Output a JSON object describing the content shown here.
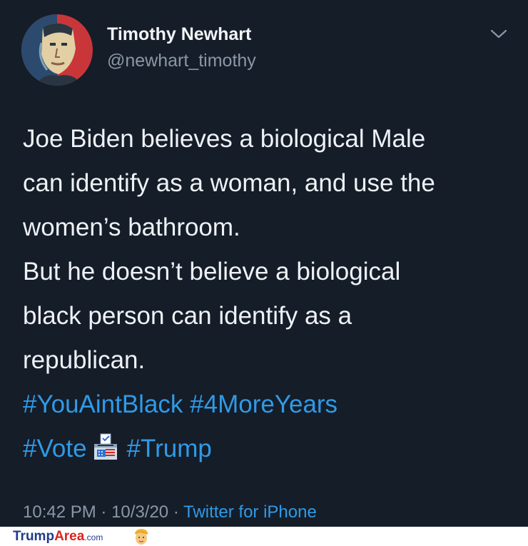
{
  "tweet": {
    "author_name": "Timothy Newhart",
    "author_handle": "@newhart_timothy",
    "lines": [
      "Joe Biden believes a biological Male",
      "can identify as a woman, and use the",
      "women’s bathroom.",
      "But he doesn’t believe a biological",
      "black person can identify as a",
      "republican."
    ],
    "hashtags_line1": [
      "#YouAintBlack",
      "#4MoreYears"
    ],
    "hashtags_line2": [
      "#Vote",
      "#Trump"
    ],
    "inline_icon": "ballot-box-emoji",
    "time": "10:42 PM",
    "date": "10/3/20",
    "separator": "·",
    "source": "Twitter for iPhone"
  },
  "footer": {
    "brand_part1": "Trump",
    "brand_part2": "Area",
    "brand_part3": ".com",
    "logo_icon": "trump-face-icon"
  },
  "colors": {
    "background": "#151d28",
    "text": "#eef2f6",
    "secondary_text": "#8a97a5",
    "link": "#2f9ae8",
    "brand_blue": "#1f3b8a",
    "brand_red": "#d9241c"
  }
}
